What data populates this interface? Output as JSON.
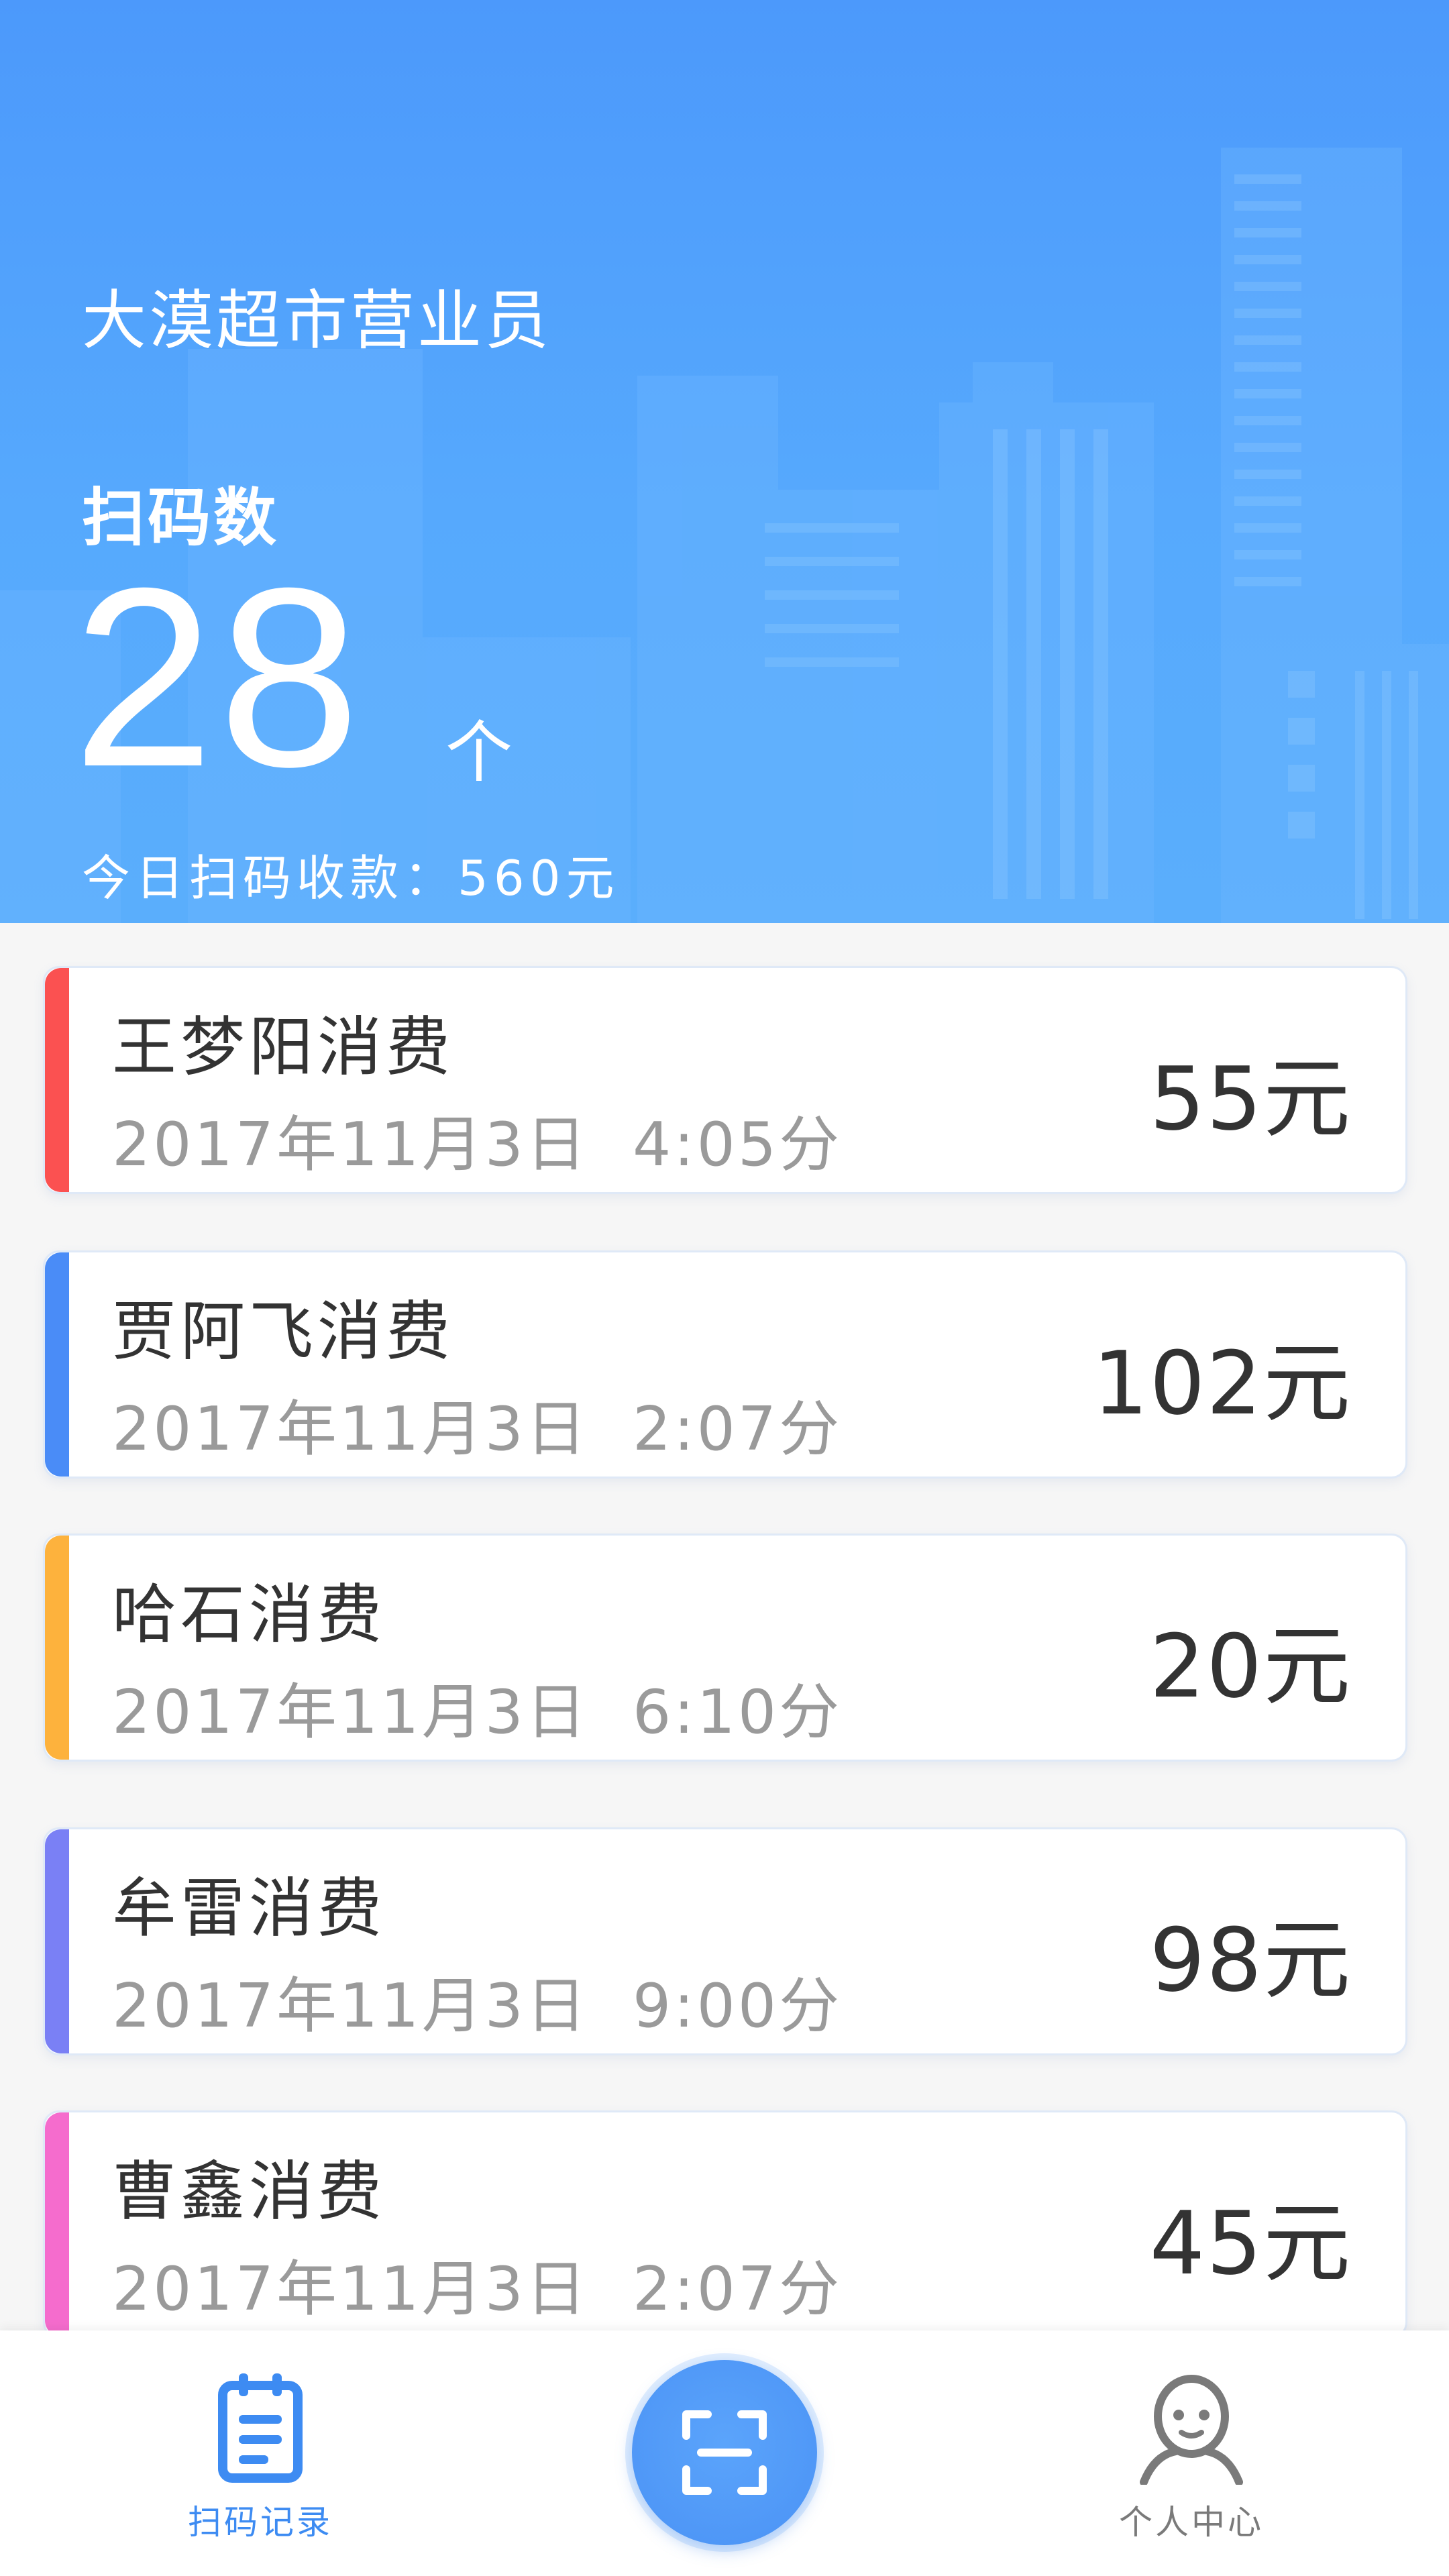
{
  "header": {
    "shop_name": "大漠超市营业员",
    "scan_label": "扫码数",
    "scan_count": "28",
    "scan_unit": "个",
    "income_label": "今日扫码收款：",
    "income_value": "560元"
  },
  "records": [
    {
      "title": "王梦阳消费",
      "time": "2017年11月3日  4:05分",
      "amount": "55元",
      "accent_color": "#fb5151"
    },
    {
      "title": "贾阿飞消费",
      "time": "2017年11月3日  2:07分",
      "amount": "102元",
      "accent_color": "#4a8cf7"
    },
    {
      "title": "哈石消费",
      "time": "2017年11月3日  6:10分",
      "amount": "20元",
      "accent_color": "#fdb23d"
    },
    {
      "title": "牟雷消费",
      "time": "2017年11月3日  9:00分",
      "amount": "98元",
      "accent_color": "#7a80f5"
    },
    {
      "title": "曹鑫消费",
      "time": "2017年11月3日  2:07分",
      "amount": "45元",
      "accent_color": "#f56ccd"
    }
  ],
  "tabbar": {
    "records_label": "扫码记录",
    "records_icon": "notebook-icon",
    "scan_icon": "scan-icon",
    "profile_label": "个人中心",
    "profile_icon": "person-icon",
    "active_color": "#3d8bf2",
    "inactive_color": "#7a7a7a"
  }
}
